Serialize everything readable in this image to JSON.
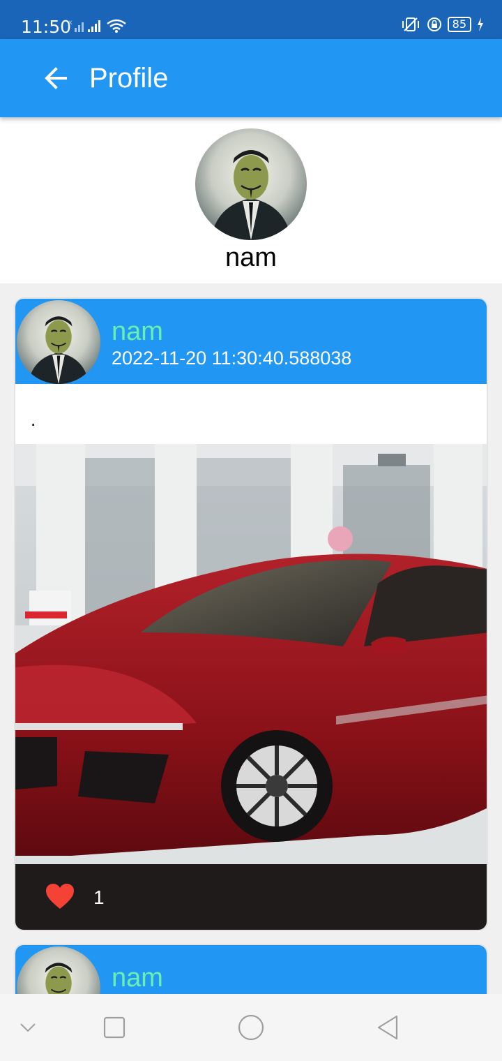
{
  "status_bar": {
    "time": "11:50",
    "battery": "85",
    "icons": [
      "signal-x-icon",
      "signal-icon",
      "wifi-icon",
      "vibrate-icon",
      "lock-rotation-icon",
      "battery-icon",
      "charging-icon"
    ]
  },
  "app_bar": {
    "title": "Profile",
    "back_icon": "arrow-left-icon"
  },
  "profile": {
    "name": "nam"
  },
  "posts": [
    {
      "author": "nam",
      "date": "2022-11-20 11:30:40.588038",
      "text": ".",
      "likes": "1",
      "like_icon": "heart-icon"
    },
    {
      "author": "nam"
    }
  ],
  "nav_bar": {
    "icons": [
      "chevron-down-icon",
      "recents-icon",
      "home-icon",
      "back-icon"
    ]
  },
  "colors": {
    "status_bar": "#1a65b8",
    "primary": "#2196f3",
    "author_name": "#69f0ae",
    "like_bar": "#1e1b1a",
    "heart": "#f44336"
  }
}
